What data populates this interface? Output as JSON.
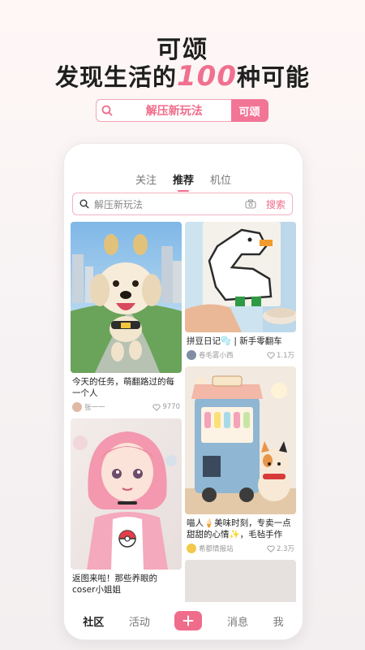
{
  "hero": {
    "title": "可颂",
    "subtitle_before": "发现生活的",
    "subtitle_highlight": "100",
    "subtitle_after": "种可能",
    "promo_search_text": "解压新玩法",
    "promo_button": "可颂"
  },
  "tabs": [
    {
      "label": "关注",
      "active": false
    },
    {
      "label": "推荐",
      "active": true
    },
    {
      "label": "机位",
      "active": false
    }
  ],
  "search": {
    "placeholder": "解压新玩法",
    "button": "搜索"
  },
  "feed": {
    "left": [
      {
        "title": "今天的任务，萌翻路过的每一个人",
        "author": "张一一",
        "likes": "9770",
        "image": "golden-retriever-puppy"
      },
      {
        "title": "返图来啦！那些养眼的coser小姐姐",
        "author": "",
        "likes": "",
        "image": "pink-hair-cosplayer"
      }
    ],
    "right": [
      {
        "title": "拼豆日记🫧 | 新手零翻车",
        "author": "卷毛雾小西",
        "likes": "1.1万",
        "image": "pixel-duck-bead-art"
      },
      {
        "title": "喵人🍦美味时刻，专卖一点甜甜的心情✨，毛毡手作",
        "author": "希都情报站",
        "likes": "2.3万",
        "image": "felt-cat-ice-cream-cart"
      },
      {
        "title": "",
        "author": "",
        "likes": "",
        "image": "partial-next-card"
      }
    ]
  },
  "bottom_nav": [
    {
      "label": "社区",
      "active": true
    },
    {
      "label": "活动",
      "active": false
    },
    {
      "label": "消息",
      "active": false
    },
    {
      "label": "我",
      "active": false
    }
  ],
  "colors": {
    "accent": "#f06c8b",
    "text": "#222222"
  }
}
